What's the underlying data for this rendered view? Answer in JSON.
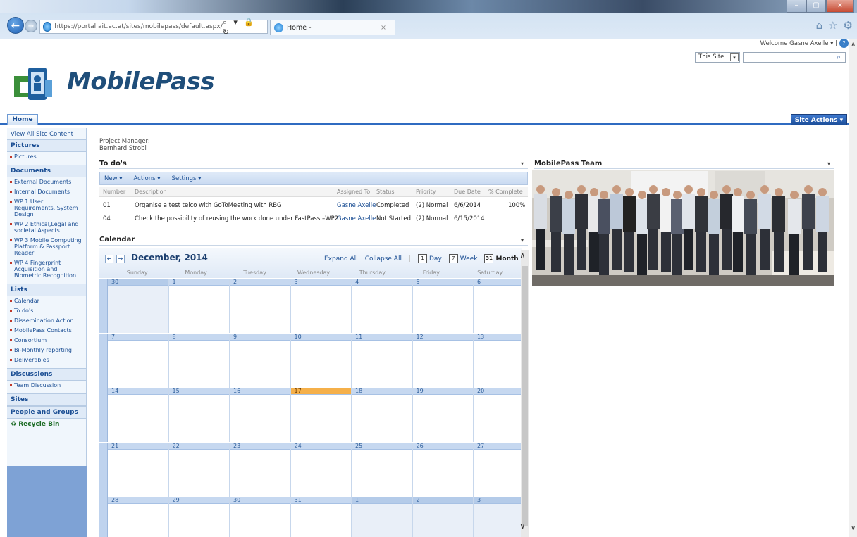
{
  "browser": {
    "address": "https://portal.ait.ac.at/sites/mobilepass/default.aspx/",
    "address_controls": "⌕ ▾ 🔒 ↻",
    "tab_title": "Home -",
    "tab_close": "×",
    "back": "←",
    "forward": "→",
    "icons": [
      "home-icon",
      "star-icon",
      "gear-icon"
    ],
    "window_controls": [
      "–",
      "▢",
      "x"
    ]
  },
  "sharepoint": {
    "welcome": "Welcome Gasne Axelle ▾  |",
    "help": "?",
    "search_scope": "This Site",
    "search_scope_arrow": "▾",
    "search_placeholder": "",
    "search_button": "⌕",
    "site_title": "MobilePass",
    "home_tab": "Home",
    "site_actions": "Site Actions ▾"
  },
  "leftnav": {
    "view_all": "View All Site Content",
    "pictures_header": "Pictures",
    "pictures_items": [
      "Pictures"
    ],
    "documents_header": "Documents",
    "documents_items": [
      "External Documents",
      "Internal Documents",
      "WP 1 User Requirements, System Design",
      "WP 2 Ethical,Legal and societal Aspects",
      "WP 3 Mobile Computing Platform & Passport Reader",
      "WP 4 Fingerprint Acquisition and Biometric Recognition"
    ],
    "lists_header": "Lists",
    "lists_items": [
      "Calendar",
      "To do's",
      "Dissemination Action",
      "MobilePass Contacts",
      "Consortium",
      "Bi-Monthly reporting",
      "Deliverables"
    ],
    "discussions_header": "Discussions",
    "discussions_items": [
      "Team Discussion"
    ],
    "sites_header": "Sites",
    "people_header": "People and Groups",
    "recycle": "Recycle Bin"
  },
  "main": {
    "pm_label": "Project Manager:",
    "pm_name": "Bernhard Strobl",
    "todos": {
      "title": "To do's",
      "menu_arrow": "▾",
      "toolbar": [
        "New ▾",
        "Actions ▾",
        "Settings ▾"
      ],
      "columns": [
        "Number",
        "Description",
        "Assigned To",
        "Status",
        "Priority",
        "Due Date",
        "% Complete"
      ],
      "rows": [
        {
          "number": "01",
          "description": "Organise a test telco with GoToMeeting with RBG",
          "assigned": "Gasne Axelle",
          "status": "Completed",
          "priority": "(2) Normal",
          "due": "6/6/2014",
          "complete": "100%"
        },
        {
          "number": "04",
          "description": "Check the possibility of reusing the work done under FastPass –WP2",
          "assigned": "Gasne Axelle",
          "status": "Not Started",
          "priority": "(2) Normal",
          "due": "6/15/2014",
          "complete": ""
        }
      ]
    },
    "calendar": {
      "title": "Calendar",
      "menu_arrow": "▾",
      "prev": "←",
      "next": "→",
      "month": "December, 2014",
      "expand_all": "Expand All",
      "collapse_all": "Collapse All",
      "separator": "|",
      "day_label": "Day",
      "week_label": "Week",
      "month_label": "Month",
      "day_icon": "1",
      "week_icon": "7",
      "month_icon": "31",
      "scroll_up": "∧",
      "scroll_down": "∨",
      "weekdays": [
        "Sunday",
        "Monday",
        "Tuesday",
        "Wednesday",
        "Thursday",
        "Friday",
        "Saturday"
      ],
      "weeks": [
        [
          "30",
          "1",
          "2",
          "3",
          "4",
          "5",
          "6"
        ],
        [
          "7",
          "8",
          "9",
          "10",
          "11",
          "12",
          "13"
        ],
        [
          "14",
          "15",
          "16",
          "17",
          "18",
          "19",
          "20"
        ],
        [
          "21",
          "22",
          "23",
          "24",
          "25",
          "26",
          "27"
        ],
        [
          "28",
          "29",
          "30",
          "31",
          "1",
          "2",
          "3"
        ]
      ],
      "today": "17"
    },
    "team": {
      "title": "MobilePass Team",
      "menu_arrow": "▾"
    }
  },
  "page_scroll": {
    "up": "∧",
    "down": "∨"
  }
}
